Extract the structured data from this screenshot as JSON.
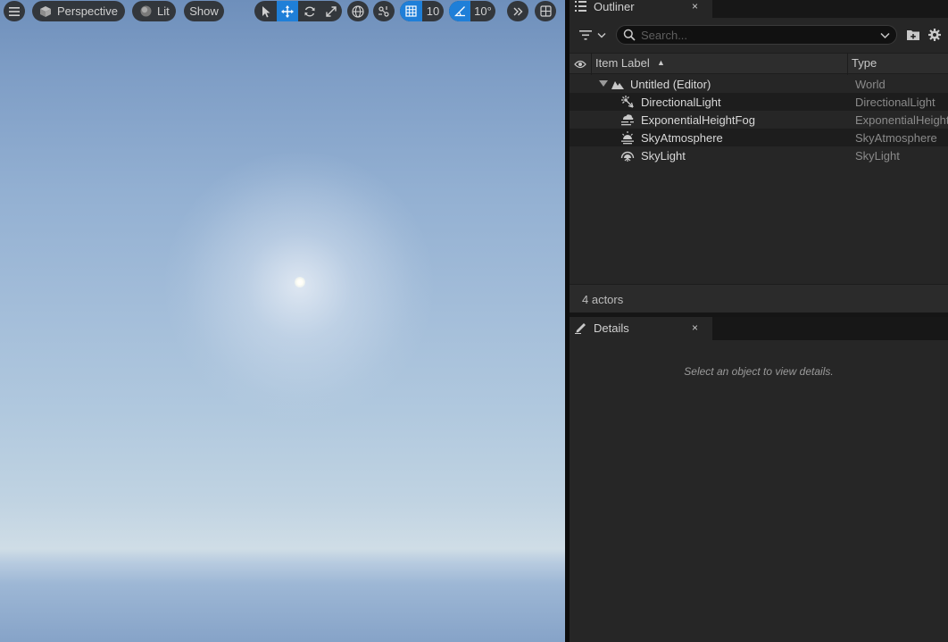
{
  "viewport": {
    "perspective_label": "Perspective",
    "lit_label": "Lit",
    "show_label": "Show",
    "grid_snap_value": "10",
    "rotation_snap_value": "10°",
    "accent_color": "#1f7fd8"
  },
  "outliner": {
    "tab_title": "Outliner",
    "close_glyph": "×",
    "search_placeholder": "Search...",
    "columns": {
      "label": "Item Label",
      "sort_glyph": "▲",
      "type": "Type"
    },
    "rows": [
      {
        "label": "Untitled (Editor)",
        "type": "World",
        "icon": "world-icon"
      },
      {
        "label": "DirectionalLight",
        "type": "DirectionalLight",
        "icon": "directional-light-icon"
      },
      {
        "label": "ExponentialHeightFog",
        "type": "ExponentialHeightFog",
        "icon": "height-fog-icon"
      },
      {
        "label": "SkyAtmosphere",
        "type": "SkyAtmosphere",
        "icon": "sky-atmosphere-icon"
      },
      {
        "label": "SkyLight",
        "type": "SkyLight",
        "icon": "sky-light-icon"
      }
    ],
    "actor_count": "4 actors"
  },
  "details": {
    "tab_title": "Details",
    "close_glyph": "×",
    "empty_message": "Select an object to view details."
  }
}
